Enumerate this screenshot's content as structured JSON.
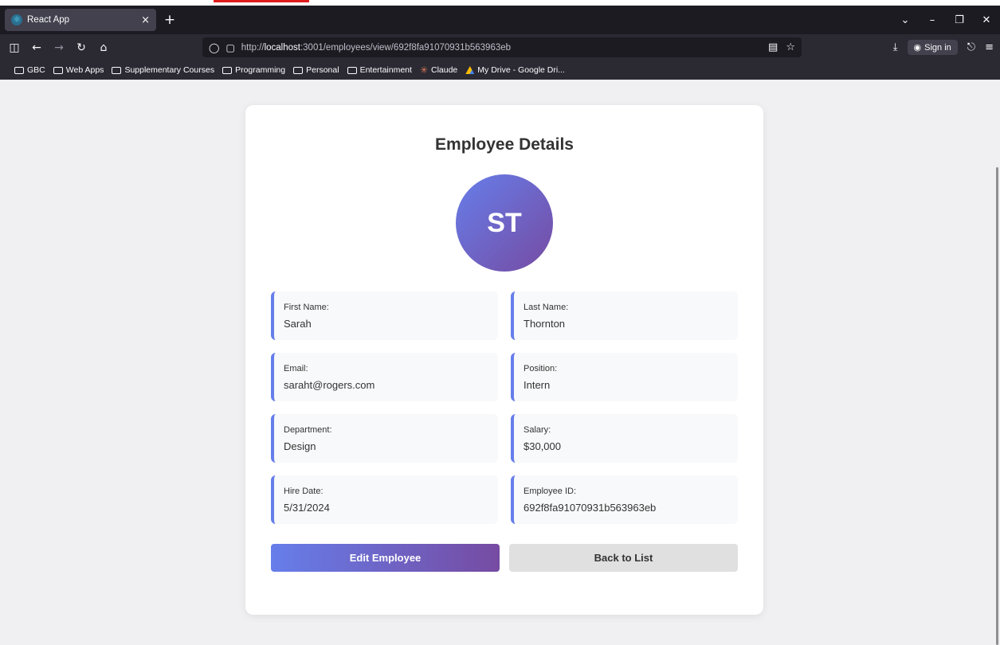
{
  "browser": {
    "tab_title": "React App",
    "tab_close": "×",
    "new_tab": "+",
    "url_prefix": "http://",
    "url_host": "localhost",
    "url_path": ":3001/employees/view/692f8fa91070931b563963eb",
    "signin_label": "Sign in",
    "bookmarks": [
      {
        "label": "GBC",
        "icon": "folder-icon"
      },
      {
        "label": "Web Apps",
        "icon": "folder-icon"
      },
      {
        "label": "Supplementary Courses",
        "icon": "folder-icon"
      },
      {
        "label": "Programming",
        "icon": "folder-icon"
      },
      {
        "label": "Personal",
        "icon": "folder-icon"
      },
      {
        "label": "Entertainment",
        "icon": "folder-icon"
      },
      {
        "label": "Claude",
        "icon": "claude-icon"
      },
      {
        "label": "My Drive - Google Dri...",
        "icon": "google-drive-icon"
      }
    ]
  },
  "page": {
    "title": "Employee Details",
    "avatar_initials": "ST",
    "fields": {
      "first_name": {
        "label": "First Name:",
        "value": "Sarah"
      },
      "last_name": {
        "label": "Last Name:",
        "value": "Thornton"
      },
      "email": {
        "label": "Email:",
        "value": "saraht@rogers.com"
      },
      "position": {
        "label": "Position:",
        "value": "Intern"
      },
      "department": {
        "label": "Department:",
        "value": "Design"
      },
      "salary": {
        "label": "Salary:",
        "value": "$30,000"
      },
      "hire_date": {
        "label": "Hire Date:",
        "value": "5/31/2024"
      },
      "employee_id": {
        "label": "Employee ID:",
        "value": "692f8fa91070931b563963eb"
      }
    },
    "buttons": {
      "edit": "Edit Employee",
      "back": "Back to List"
    }
  },
  "colors": {
    "accent_start": "#667eea",
    "accent_end": "#764ba2",
    "card_bg": "#ffffff",
    "field_bg": "#f8f9fa",
    "back_button_bg": "#e0e0e0"
  }
}
